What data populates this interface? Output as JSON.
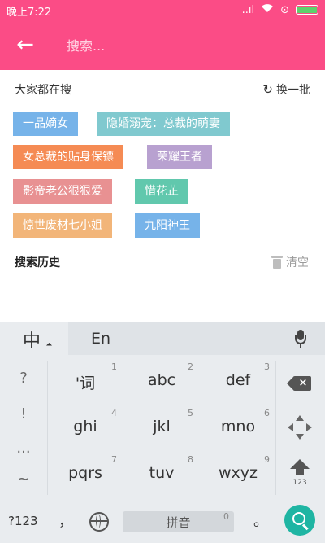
{
  "status_bar": {
    "time": "晚上7:22",
    "signal_text": "..ıl",
    "hd_text": "⊙"
  },
  "app_bar": {
    "back_label": "←",
    "search_placeholder": "搜索..."
  },
  "hot_search": {
    "title": "大家都在搜",
    "refresh_label": "换一批",
    "tags": [
      "一品嫡女",
      "隐婚溺宠：总裁的萌妻",
      "女总裁的贴身保镖",
      "荣耀王者",
      "影帝老公狠狠爱",
      "惜花芷",
      "惊世废材七小姐",
      "九阳神王"
    ]
  },
  "history": {
    "title": "搜索历史",
    "clear_label": "清空"
  },
  "keyboard": {
    "lang_zh": "中",
    "lang_en": "En",
    "punctuation": [
      "?",
      "!",
      "...",
      "~"
    ],
    "keys": [
      {
        "label": "'词",
        "num": "1"
      },
      {
        "label": "abc",
        "num": "2"
      },
      {
        "label": "def",
        "num": "3"
      },
      {
        "label": "ghi",
        "num": "4"
      },
      {
        "label": "jkl",
        "num": "5"
      },
      {
        "label": "mno",
        "num": "6"
      },
      {
        "label": "pqrs",
        "num": "7"
      },
      {
        "label": "tuv",
        "num": "8"
      },
      {
        "label": "wxyz",
        "num": "9"
      }
    ],
    "shift_label": "123",
    "symbols_label": "?123",
    "comma_label": "，",
    "space_label": "拼音",
    "space_num": "0",
    "period_label": "。"
  },
  "colors": {
    "accent": "#fb4c86",
    "go_button": "#1fb5a3"
  }
}
